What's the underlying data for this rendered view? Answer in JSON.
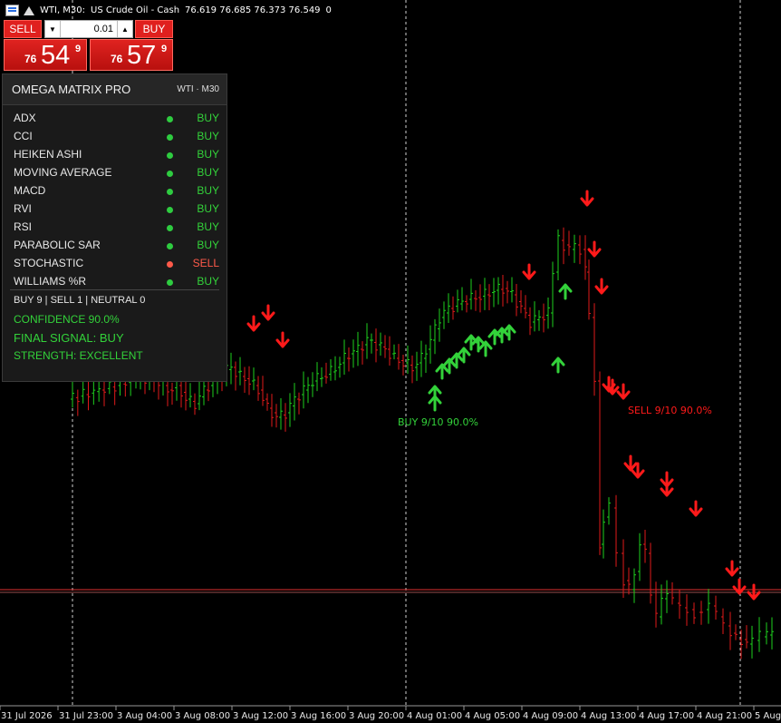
{
  "title": {
    "symbol": "WTI, M30:",
    "name": "US Crude Oil - Cash",
    "ohlc": "76.619 76.685 76.373 76.549",
    "zero": "0"
  },
  "trade": {
    "sell_label": "SELL",
    "buy_label": "BUY",
    "lot": "0.01",
    "sell_prefix": "76",
    "sell_big": "54",
    "sell_sup": "9",
    "buy_prefix": "76",
    "buy_big": "57",
    "buy_sup": "9"
  },
  "panel": {
    "title": "OMEGA MATRIX PRO",
    "symbol": "WTI · M30",
    "indicators": [
      {
        "name": "ADX",
        "signal": "BUY"
      },
      {
        "name": "CCI",
        "signal": "BUY"
      },
      {
        "name": "HEIKEN ASHI",
        "signal": "BUY"
      },
      {
        "name": "MOVING AVERAGE",
        "signal": "BUY"
      },
      {
        "name": "MACD",
        "signal": "BUY"
      },
      {
        "name": "RVI",
        "signal": "BUY"
      },
      {
        "name": "RSI",
        "signal": "BUY"
      },
      {
        "name": "PARABOLIC SAR",
        "signal": "BUY"
      },
      {
        "name": "STOCHASTIC",
        "signal": "SELL"
      },
      {
        "name": "WILLIAMS %R",
        "signal": "BUY"
      }
    ],
    "counts": "BUY 9  |  SELL 1  |  NEUTRAL 0",
    "confidence": "CONFIDENCE 90.0%",
    "final": "FINAL SIGNAL: BUY",
    "strength": "STRENGTH: EXCELLENT"
  },
  "colors": {
    "buy": "#33d23a",
    "sell": "#ff1a1a",
    "bull_candle": "#1ed01e",
    "bear_candle": "#e01a1a",
    "grid": "#cfcfcf",
    "bid_line": "#e03030"
  },
  "chart_data": {
    "type": "candlestick",
    "x_ticks": [
      "31 Jul 2026",
      "31 Jul 23:00",
      "3 Aug 04:00",
      "3 Aug 08:00",
      "3 Aug 12:00",
      "3 Aug 16:00",
      "3 Aug 20:00",
      "4 Aug 01:00",
      "4 Aug 05:00",
      "4 Aug 09:00",
      "4 Aug 13:00",
      "4 Aug 17:00",
      "4 Aug 21:00",
      "5 Aug 0"
    ],
    "annotations": [
      {
        "text": "BUY 9/10  90.0%",
        "color": "buy"
      },
      {
        "text": "SELL 9/10  90.0%",
        "color": "sell"
      }
    ],
    "bid_price": 76.549,
    "ask_price": 76.579
  }
}
